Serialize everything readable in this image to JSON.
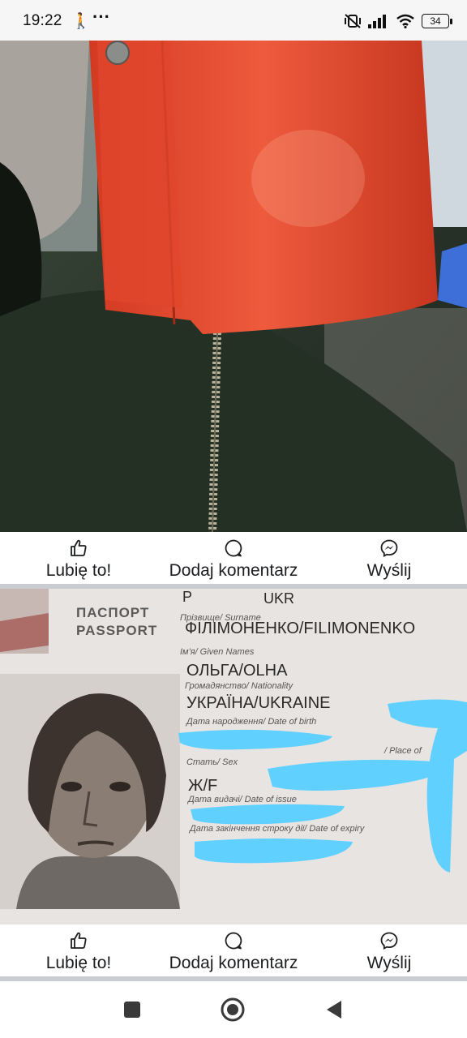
{
  "status_bar": {
    "time": "19:22",
    "walk_icon": "walking-person-icon",
    "more": "···",
    "battery": "34"
  },
  "post1": {
    "photo": "photo of red wallet and jacket zipper",
    "actions": {
      "like": "Lubię to!",
      "comment": "Dodaj komentarz",
      "send": "Wyślij"
    }
  },
  "post2": {
    "passport": {
      "doc_type": "P",
      "country": "UKR",
      "title_ua": "ПАСПОРТ",
      "title_en": "PASSPORT",
      "surname_label": "Прізвище/ Surname",
      "surname": "ФІЛІМОНЕНКО/FILIMONENKO",
      "given_label": "Ім'я/ Given Names",
      "given": "ОЛЬГА/OLHA",
      "nationality_label": "Громадянство/ Nationality",
      "nationality": "УКРАЇНА/UKRAINE",
      "dob_label": "Дата народження/ Date of birth",
      "sex_label": "Стать/ Sex",
      "pob_label": "/ Place of",
      "sex": "Ж/F",
      "issue_label": "Дата видачі/ Date of issue",
      "expiry_label": "Дата закінчення строку дії/ Date of expiry"
    },
    "actions": {
      "like": "Lubię to!",
      "comment": "Dodaj komentarz",
      "send": "Wyślij"
    }
  },
  "colors": {
    "redaction": "#5fd0ff",
    "wallet": "#e2452b",
    "jacket": "#2d372c"
  }
}
